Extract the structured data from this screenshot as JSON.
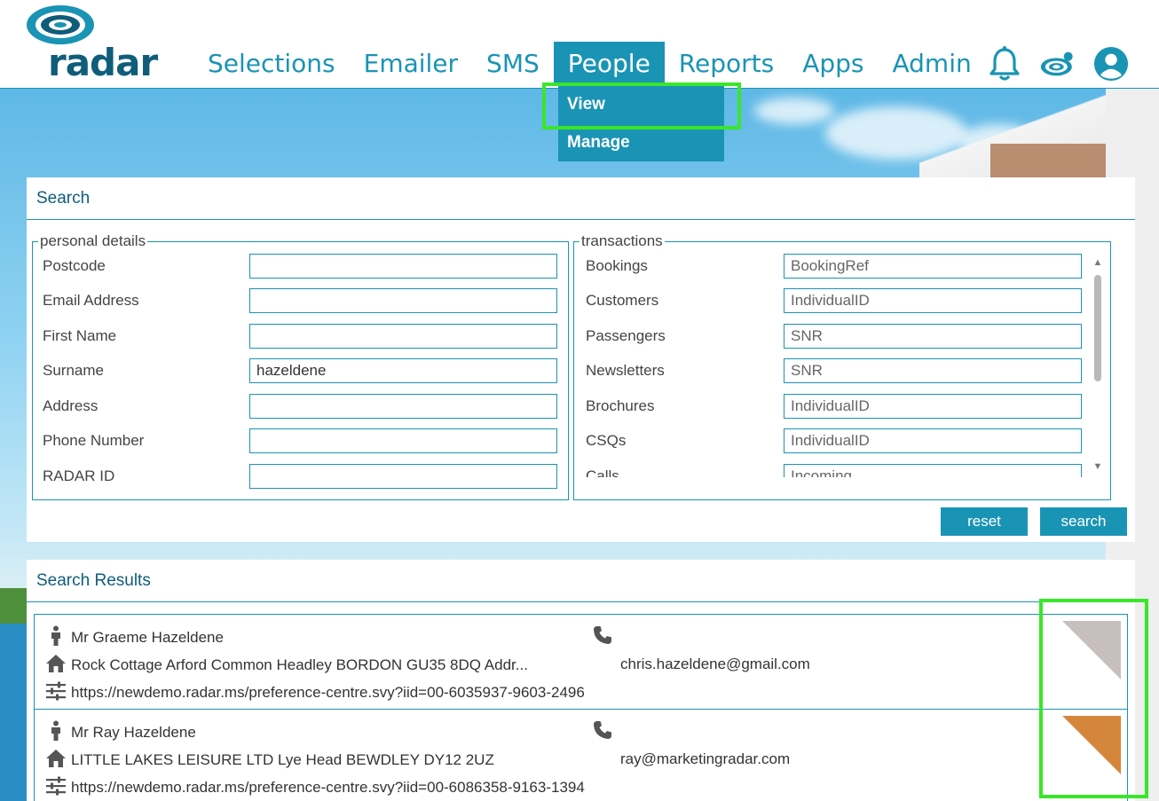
{
  "brand": {
    "name": "radar",
    "accent": "#1a94b4",
    "dark": "#0f5d7a",
    "highlight": "#39e62a"
  },
  "nav": {
    "items": [
      {
        "label": "Selections",
        "active": false
      },
      {
        "label": "Emailer",
        "active": false
      },
      {
        "label": "SMS",
        "active": false
      },
      {
        "label": "People",
        "active": true
      },
      {
        "label": "Reports",
        "active": false
      },
      {
        "label": "Apps",
        "active": false
      },
      {
        "label": "Admin",
        "active": false
      }
    ],
    "icons": [
      "bell-icon",
      "radar-notification-icon",
      "user-account-icon"
    ]
  },
  "dropdown": {
    "items": [
      "View",
      "Manage"
    ]
  },
  "search": {
    "title": "Search",
    "personal": {
      "legend": "personal details",
      "fields": [
        {
          "label": "Postcode",
          "value": ""
        },
        {
          "label": "Email Address",
          "value": ""
        },
        {
          "label": "First Name",
          "value": ""
        },
        {
          "label": "Surname",
          "value": "hazeldene"
        },
        {
          "label": "Address",
          "value": ""
        },
        {
          "label": "Phone Number",
          "value": ""
        },
        {
          "label": "RADAR ID",
          "value": ""
        }
      ]
    },
    "transactions": {
      "legend": "transactions",
      "fields": [
        {
          "label": "Bookings",
          "placeholder": "BookingRef"
        },
        {
          "label": "Customers",
          "placeholder": "IndividualID"
        },
        {
          "label": "Passengers",
          "placeholder": "SNR"
        },
        {
          "label": "Newsletters",
          "placeholder": "SNR"
        },
        {
          "label": "Brochures",
          "placeholder": "IndividualID"
        },
        {
          "label": "CSQs",
          "placeholder": "IndividualID"
        },
        {
          "label": "Calls",
          "placeholder": "Incoming"
        }
      ]
    },
    "reset_label": "reset",
    "search_label": "search"
  },
  "results": {
    "title": "Search Results",
    "items": [
      {
        "name": "Mr Graeme Hazeldene",
        "address": "Rock Cottage Arford Common Headley BORDON GU35 8DQ Addr...",
        "url": "https://newdemo.radar.ms/preference-centre.svy?iid=00-6035937-9603-2496",
        "email": "chris.hazeldene@gmail.com",
        "tag_color": "#c7bfbd"
      },
      {
        "name": "Mr Ray Hazeldene",
        "address": "LITTLE LAKES LEISURE LTD Lye Head BEWDLEY DY12 2UZ",
        "url": "https://newdemo.radar.ms/preference-centre.svy?iid=00-6086358-9163-1394",
        "email": "ray@marketingradar.com",
        "tag_color": "#d4873a"
      }
    ]
  }
}
